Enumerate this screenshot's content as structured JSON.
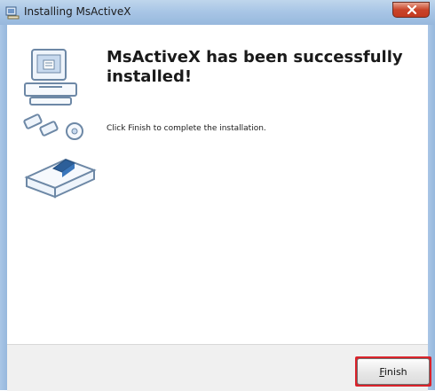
{
  "window": {
    "title": "Installing MsActiveX"
  },
  "content": {
    "heading": "MsActiveX has been successfully installed!",
    "instructions": "Click Finish to complete the installation."
  },
  "footer": {
    "finish_label": "Finish"
  },
  "colors": {
    "accent_red": "#d9232b",
    "titlebar": "#a9c6e6",
    "close_button": "#c9442a"
  },
  "icons": [
    "setup-icon",
    "close-icon",
    "computer-install-graphic"
  ]
}
